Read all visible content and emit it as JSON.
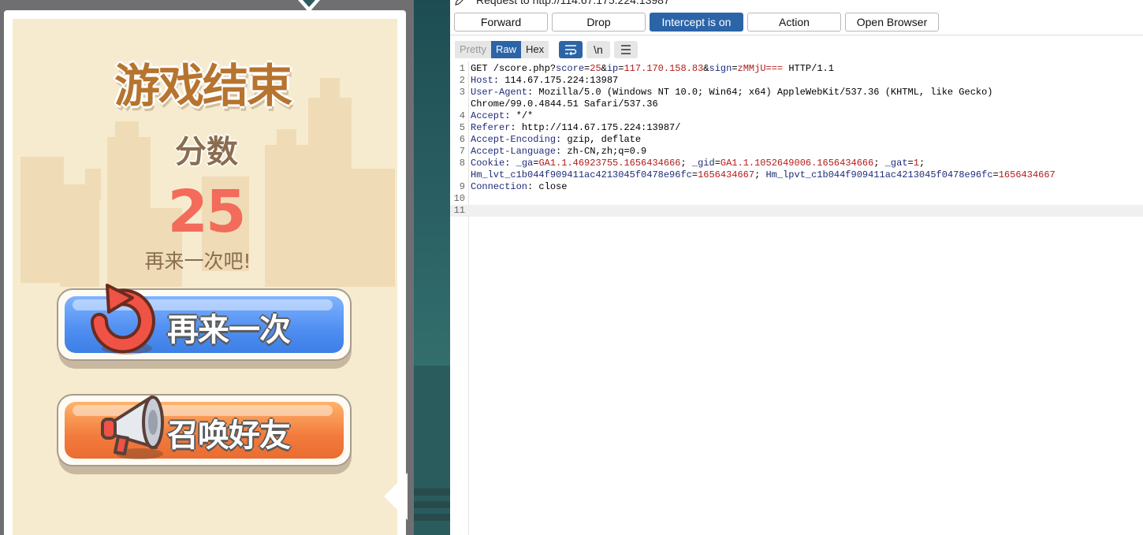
{
  "game": {
    "title": "游戏结束",
    "score_label": "分数",
    "score": "25",
    "retry_message": "再来一次吧!",
    "retry_button": "再来一次",
    "invite_button": "召唤好友"
  },
  "proxy": {
    "request_title": "Request to http://114.67.175.224:13987",
    "buttons": {
      "forward": "Forward",
      "drop": "Drop",
      "intercept": "Intercept is on",
      "action": "Action",
      "open_browser": "Open Browser"
    },
    "view_tabs": [
      "Pretty",
      "Raw",
      "Hex"
    ],
    "selected_tab": "Raw",
    "newline_toggle": "\\n",
    "accent_color": "#2c64a8",
    "request_lines": [
      {
        "num": "1",
        "parts": [
          [
            "t",
            "GET /score.php?"
          ],
          [
            "k",
            "score"
          ],
          [
            "t",
            "="
          ],
          [
            "v",
            "25"
          ],
          [
            "t",
            "&"
          ],
          [
            "k",
            "ip"
          ],
          [
            "t",
            "="
          ],
          [
            "v",
            "117.170.158.83"
          ],
          [
            "t",
            "&"
          ],
          [
            "k",
            "sign"
          ],
          [
            "t",
            "="
          ],
          [
            "v",
            "zMMjU==="
          ],
          [
            "t",
            " HTTP/1.1"
          ]
        ]
      },
      {
        "num": "2",
        "parts": [
          [
            "k",
            "Host"
          ],
          [
            "t",
            ": 114.67.175.224:13987"
          ]
        ]
      },
      {
        "num": "3",
        "parts": [
          [
            "k",
            "User-Agent"
          ],
          [
            "t",
            ": Mozilla/5.0 (Windows NT 10.0; Win64; x64) AppleWebKit/537.36 (KHTML, like Gecko)"
          ]
        ]
      },
      {
        "num": "",
        "parts": [
          [
            "t",
            "Chrome/99.0.4844.51 Safari/537.36"
          ]
        ]
      },
      {
        "num": "4",
        "parts": [
          [
            "k",
            "Accept"
          ],
          [
            "t",
            ": */*"
          ]
        ]
      },
      {
        "num": "5",
        "parts": [
          [
            "k",
            "Referer"
          ],
          [
            "t",
            ": http://114.67.175.224:13987/"
          ]
        ]
      },
      {
        "num": "6",
        "parts": [
          [
            "k",
            "Accept-Encoding"
          ],
          [
            "t",
            ": gzip, deflate"
          ]
        ]
      },
      {
        "num": "7",
        "parts": [
          [
            "k",
            "Accept-Language"
          ],
          [
            "t",
            ": zh-CN,zh;q=0.9"
          ]
        ]
      },
      {
        "num": "8",
        "parts": [
          [
            "k",
            "Cookie"
          ],
          [
            "t",
            ": "
          ],
          [
            "k",
            "_ga"
          ],
          [
            "t",
            "="
          ],
          [
            "v",
            "GA1.1.46923755.1656434666"
          ],
          [
            "t",
            "; "
          ],
          [
            "k",
            "_gid"
          ],
          [
            "t",
            "="
          ],
          [
            "v",
            "GA1.1.1052649006.1656434666"
          ],
          [
            "t",
            "; "
          ],
          [
            "k",
            "_gat"
          ],
          [
            "t",
            "="
          ],
          [
            "v",
            "1"
          ],
          [
            "t",
            ";"
          ]
        ]
      },
      {
        "num": "",
        "parts": [
          [
            "k",
            "Hm_lvt_c1b044f909411ac4213045f0478e96fc"
          ],
          [
            "t",
            "="
          ],
          [
            "v",
            "1656434667"
          ],
          [
            "t",
            "; "
          ],
          [
            "k",
            "Hm_lpvt_c1b044f909411ac4213045f0478e96fc"
          ],
          [
            "t",
            "="
          ],
          [
            "v",
            "1656434667"
          ]
        ]
      },
      {
        "num": "9",
        "parts": [
          [
            "k",
            "Connection"
          ],
          [
            "t",
            ": close"
          ]
        ]
      },
      {
        "num": "10",
        "parts": []
      },
      {
        "num": "11",
        "parts": []
      }
    ]
  }
}
